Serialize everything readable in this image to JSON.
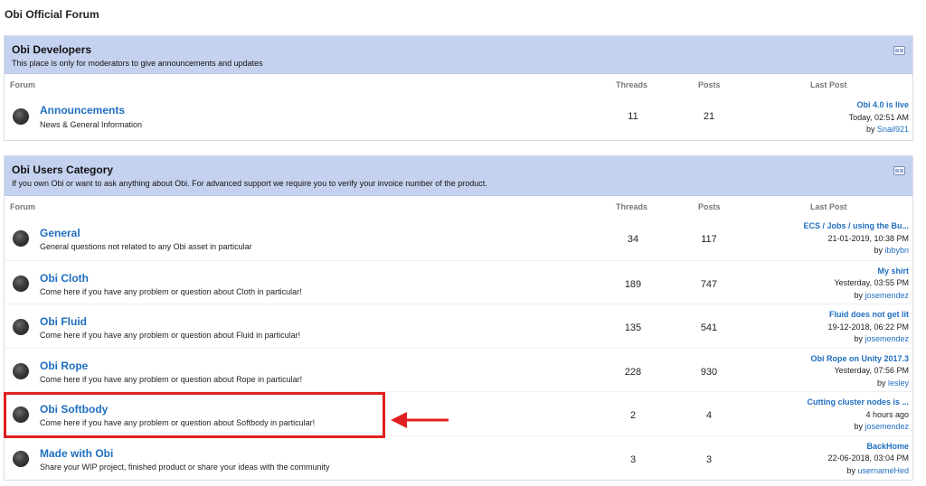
{
  "site_title": "Obi Official Forum",
  "columns": {
    "forum": "Forum",
    "threads": "Threads",
    "posts": "Posts",
    "last_post": "Last Post"
  },
  "categories": [
    {
      "title": "Obi Developers",
      "description": "This place is only for moderators to give announcements and updates",
      "forums": [
        {
          "title": "Announcements",
          "description": "News & General Information",
          "threads": "11",
          "posts": "21",
          "last_post": {
            "title": "Obi 4.0 is live",
            "date": "Today, 02:51 AM",
            "by": "by",
            "user": "Snail921"
          }
        }
      ]
    },
    {
      "title": "Obi Users Category",
      "description": "If you own Obi or want to ask anything about Obi. For advanced support we require you to verify your invoice number of the product.",
      "forums": [
        {
          "title": "General",
          "description": "General questions not related to any Obi asset in particular",
          "threads": "34",
          "posts": "117",
          "last_post": {
            "title": "ECS / Jobs / using the Bu...",
            "date": "21-01-2019, 10:38 PM",
            "by": "by",
            "user": "ibbybn"
          }
        },
        {
          "title": "Obi Cloth",
          "description": "Come here if you have any problem or question about Cloth in particular!",
          "threads": "189",
          "posts": "747",
          "last_post": {
            "title": "My shirt",
            "date": "Yesterday, 03:55 PM",
            "by": "by",
            "user": "josemendez"
          }
        },
        {
          "title": "Obi Fluid",
          "description": "Come here if you have any problem or question about Fluid in particular!",
          "threads": "135",
          "posts": "541",
          "last_post": {
            "title": "Fluid does not get lit",
            "date": "19-12-2018, 06:22 PM",
            "by": "by",
            "user": "josemendez"
          }
        },
        {
          "title": "Obi Rope",
          "description": "Come here if you have any problem or question about Rope in particular!",
          "threads": "228",
          "posts": "930",
          "last_post": {
            "title": "Obi Rope on Unity 2017.3",
            "date": "Yesterday, 07:56 PM",
            "by": "by",
            "user": "lesley"
          }
        },
        {
          "title": "Obi Softbody",
          "description": "Come here if you have any problem or question about Softbody in particular!",
          "threads": "2",
          "posts": "4",
          "last_post": {
            "title": "Cutting cluster nodes is ...",
            "date": "4 hours ago",
            "by": "by",
            "user": "josemendez"
          }
        },
        {
          "title": "Made with Obi",
          "description": "Share your WIP project, finished product or share your ideas with the community",
          "threads": "3",
          "posts": "3",
          "last_post": {
            "title": "BackHome",
            "date": "22-06-2018, 03:04 PM",
            "by": "by",
            "user": "usernameHed"
          }
        }
      ]
    }
  ],
  "annotation_color": "#e02020"
}
